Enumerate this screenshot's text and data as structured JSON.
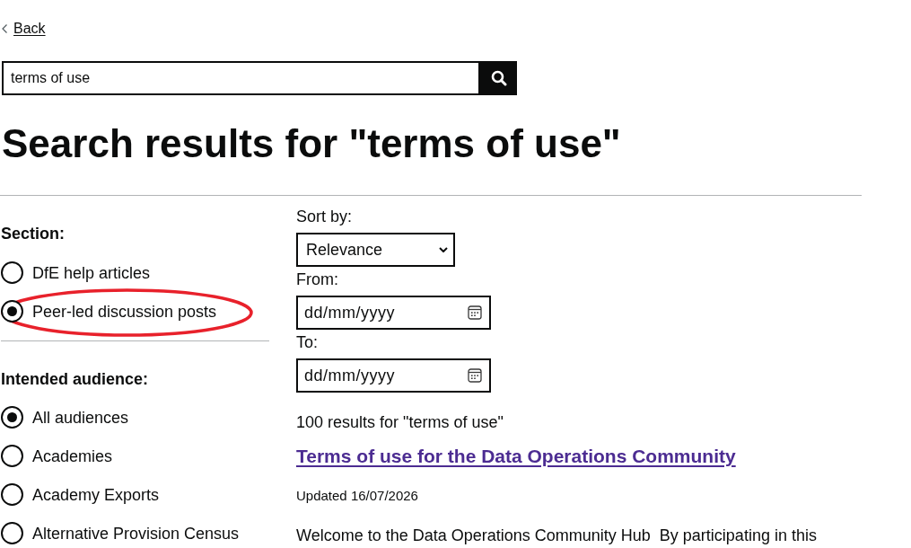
{
  "back_link": {
    "label": "Back"
  },
  "search": {
    "value": "terms of use"
  },
  "heading": "Search results for \"terms of use\"",
  "filters": [
    {
      "title": "Section:",
      "options": [
        {
          "label": "DfE help articles",
          "selected": false,
          "circled": false
        },
        {
          "label": "Peer-led discussion posts",
          "selected": true,
          "circled": true
        }
      ]
    },
    {
      "title": "Intended audience:",
      "options": [
        {
          "label": "All audiences",
          "selected": true,
          "circled": false
        },
        {
          "label": "Academies",
          "selected": false,
          "circled": false
        },
        {
          "label": "Academy Exports",
          "selected": false,
          "circled": false
        },
        {
          "label": "Alternative Provision Census",
          "selected": false,
          "circled": false
        }
      ]
    }
  ],
  "sort": {
    "label": "Sort by:",
    "value": "Relevance"
  },
  "date_filters": [
    {
      "label": "From:",
      "placeholder": "dd/mm/yyyy"
    },
    {
      "label": "To:",
      "placeholder": "dd/mm/yyyy"
    }
  ],
  "results_count": "100 results for \"terms of use\"",
  "results": [
    {
      "title": "Terms of use for the Data Operations Community",
      "updated": "Updated 16/07/2026",
      "snippet": "Welcome to the Data Operations Community Hub  By participating in this"
    }
  ]
}
